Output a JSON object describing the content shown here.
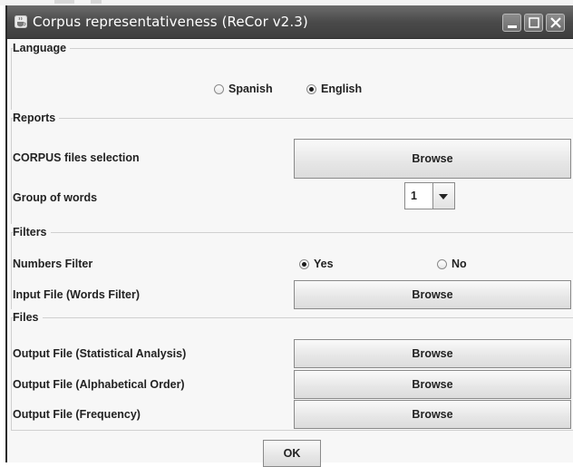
{
  "window": {
    "title": "Corpus representativeness (ReCor v2.3)",
    "icon": "java-cup-icon",
    "controls": [
      "minimize-icon",
      "maximize-icon",
      "close-icon"
    ]
  },
  "language": {
    "heading": "Language",
    "options": [
      {
        "label": "Spanish",
        "selected": false
      },
      {
        "label": "English",
        "selected": true
      }
    ]
  },
  "reports": {
    "heading": "Reports",
    "corpus_label": "CORPUS files selection",
    "corpus_button": "Browse",
    "group_label": "Group of words",
    "group_value": "1"
  },
  "filters": {
    "heading": "Filters",
    "numbers_label": "Numbers Filter",
    "numbers_options": [
      {
        "label": "Yes",
        "selected": true
      },
      {
        "label": "No",
        "selected": false
      }
    ],
    "input_label": "Input File (Words Filter)",
    "input_button": "Browse"
  },
  "files": {
    "heading": "Files",
    "rows": [
      {
        "label": "Output File (Statistical Analysis)",
        "button": "Browse"
      },
      {
        "label": "Output File  (Alphabetical Order)",
        "button": "Browse"
      },
      {
        "label": "Output File  (Frequency)",
        "button": "Browse"
      }
    ]
  },
  "ok_label": "OK"
}
